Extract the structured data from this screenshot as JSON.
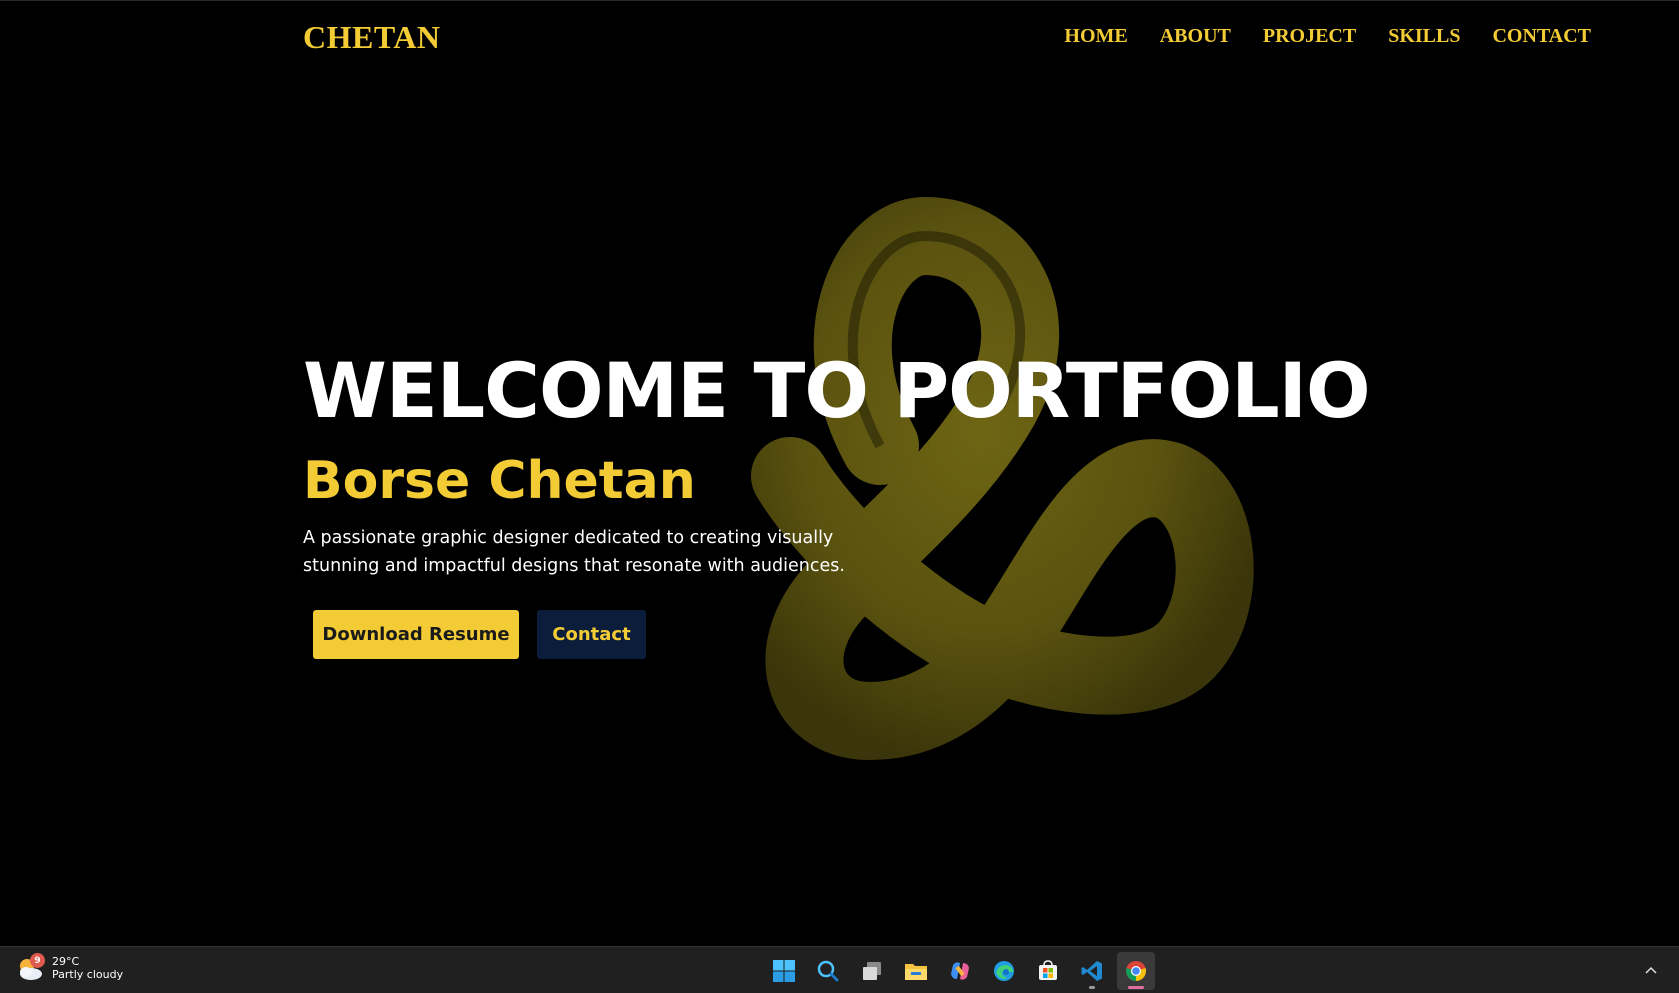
{
  "header": {
    "logo": "CHETAN",
    "nav": [
      "HOME",
      "ABOUT",
      "PROJECT",
      "SKILLS",
      "CONTACT"
    ]
  },
  "hero": {
    "title": "WELCOME TO PORTFOLIO",
    "name": "Borse Chetan",
    "description": "A passionate graphic designer dedicated to creating visually stunning and impactful designs that resonate with audiences.",
    "primary_button": "Download Resume",
    "secondary_button": "Contact"
  },
  "colors": {
    "background": "#000000",
    "accent": "#f3cc35",
    "contact_button": "#0b1d3a",
    "knot": "#5e560f"
  },
  "taskbar": {
    "weather": {
      "badge": "9",
      "temperature": "29°C",
      "condition": "Partly cloudy",
      "icon": "partly-cloudy-icon"
    },
    "apps": [
      {
        "name": "windows-start-icon",
        "active": false
      },
      {
        "name": "search-icon",
        "active": false
      },
      {
        "name": "task-view-icon",
        "active": false
      },
      {
        "name": "file-explorer-icon",
        "active": false
      },
      {
        "name": "copilot-icon",
        "active": false
      },
      {
        "name": "edge-browser-icon",
        "active": false
      },
      {
        "name": "microsoft-store-icon",
        "active": false
      },
      {
        "name": "vscode-icon",
        "active": false
      },
      {
        "name": "chrome-icon",
        "active": true
      }
    ]
  }
}
